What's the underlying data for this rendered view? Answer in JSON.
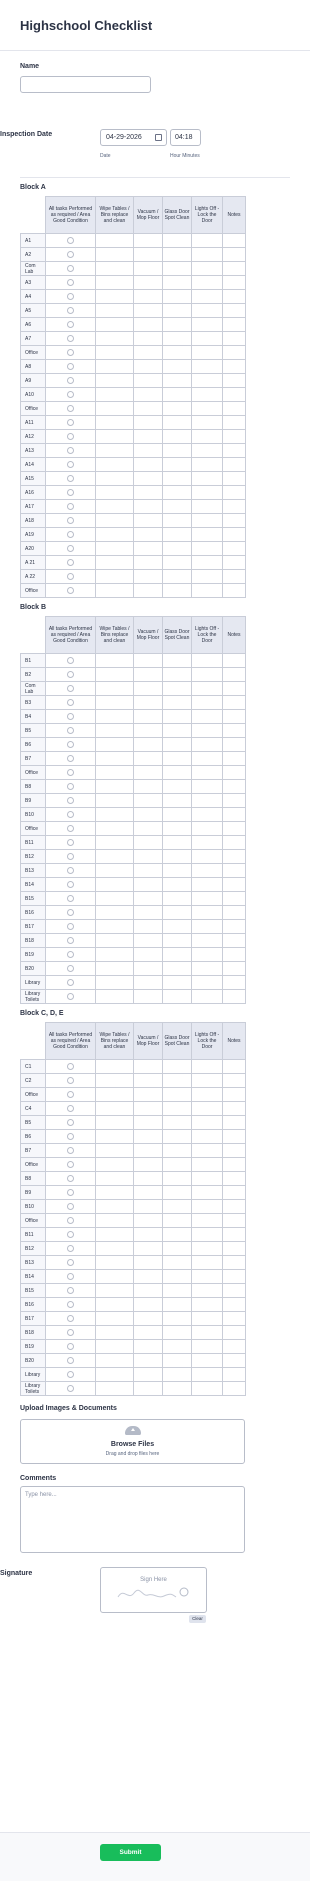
{
  "form": {
    "title": "Highschool Checklist",
    "name_label": "Name",
    "name_value": "",
    "inspection_label": "Inspection Date",
    "date_value": "04-29-2026",
    "date_sublabel": "Date",
    "time_value": "04:18",
    "time_sublabel": "Hour Minutes"
  },
  "columns": [
    "All tasks Performed as required / Area Good Condition",
    "Wipe Tables / Bins replace and clean",
    "Vacuum / Mop Floor",
    "Glass Door Spot Clean",
    "Lights Off - Lock the Door",
    "Notes"
  ],
  "blocks": [
    {
      "title": "Block A",
      "rows": [
        "A1",
        "A2",
        "Com Lab",
        "A3",
        "A4",
        "A5",
        "A6",
        "A7",
        "Office",
        "A8",
        "A9",
        "A10",
        "Office",
        "A11",
        "A12",
        "A13",
        "A14",
        "A15",
        "A16",
        "A17",
        "A18",
        "A19",
        "A20",
        "A 21",
        "A 22",
        "Office"
      ]
    },
    {
      "title": "Block B",
      "rows": [
        "B1",
        "B2",
        "Com Lab",
        "B3",
        "B4",
        "B5",
        "B6",
        "B7",
        "Office",
        "B8",
        "B9",
        "B10",
        "Office",
        "B11",
        "B12",
        "B13",
        "B14",
        "B15",
        "B16",
        "B17",
        "B18",
        "B19",
        "B20",
        "Library",
        "Library Toilets"
      ]
    },
    {
      "title": "Block C, D, E",
      "rows": [
        "C1",
        "C2",
        "Office",
        "C4",
        "B5",
        "B6",
        "B7",
        "Office",
        "B8",
        "B9",
        "B10",
        "Office",
        "B11",
        "B12",
        "B13",
        "B14",
        "B15",
        "B16",
        "B17",
        "B18",
        "B19",
        "B20",
        "Library",
        "Library Toilets"
      ]
    }
  ],
  "upload": {
    "title": "Upload Images & Documents",
    "main": "Browse Files",
    "sub": "Drag and drop files here"
  },
  "comments": {
    "title": "Comments",
    "placeholder": "Type here..."
  },
  "signature": {
    "label": "Signature",
    "placeholder": "Sign Here",
    "clear_label": "Clear"
  },
  "submit_label": "Submit"
}
